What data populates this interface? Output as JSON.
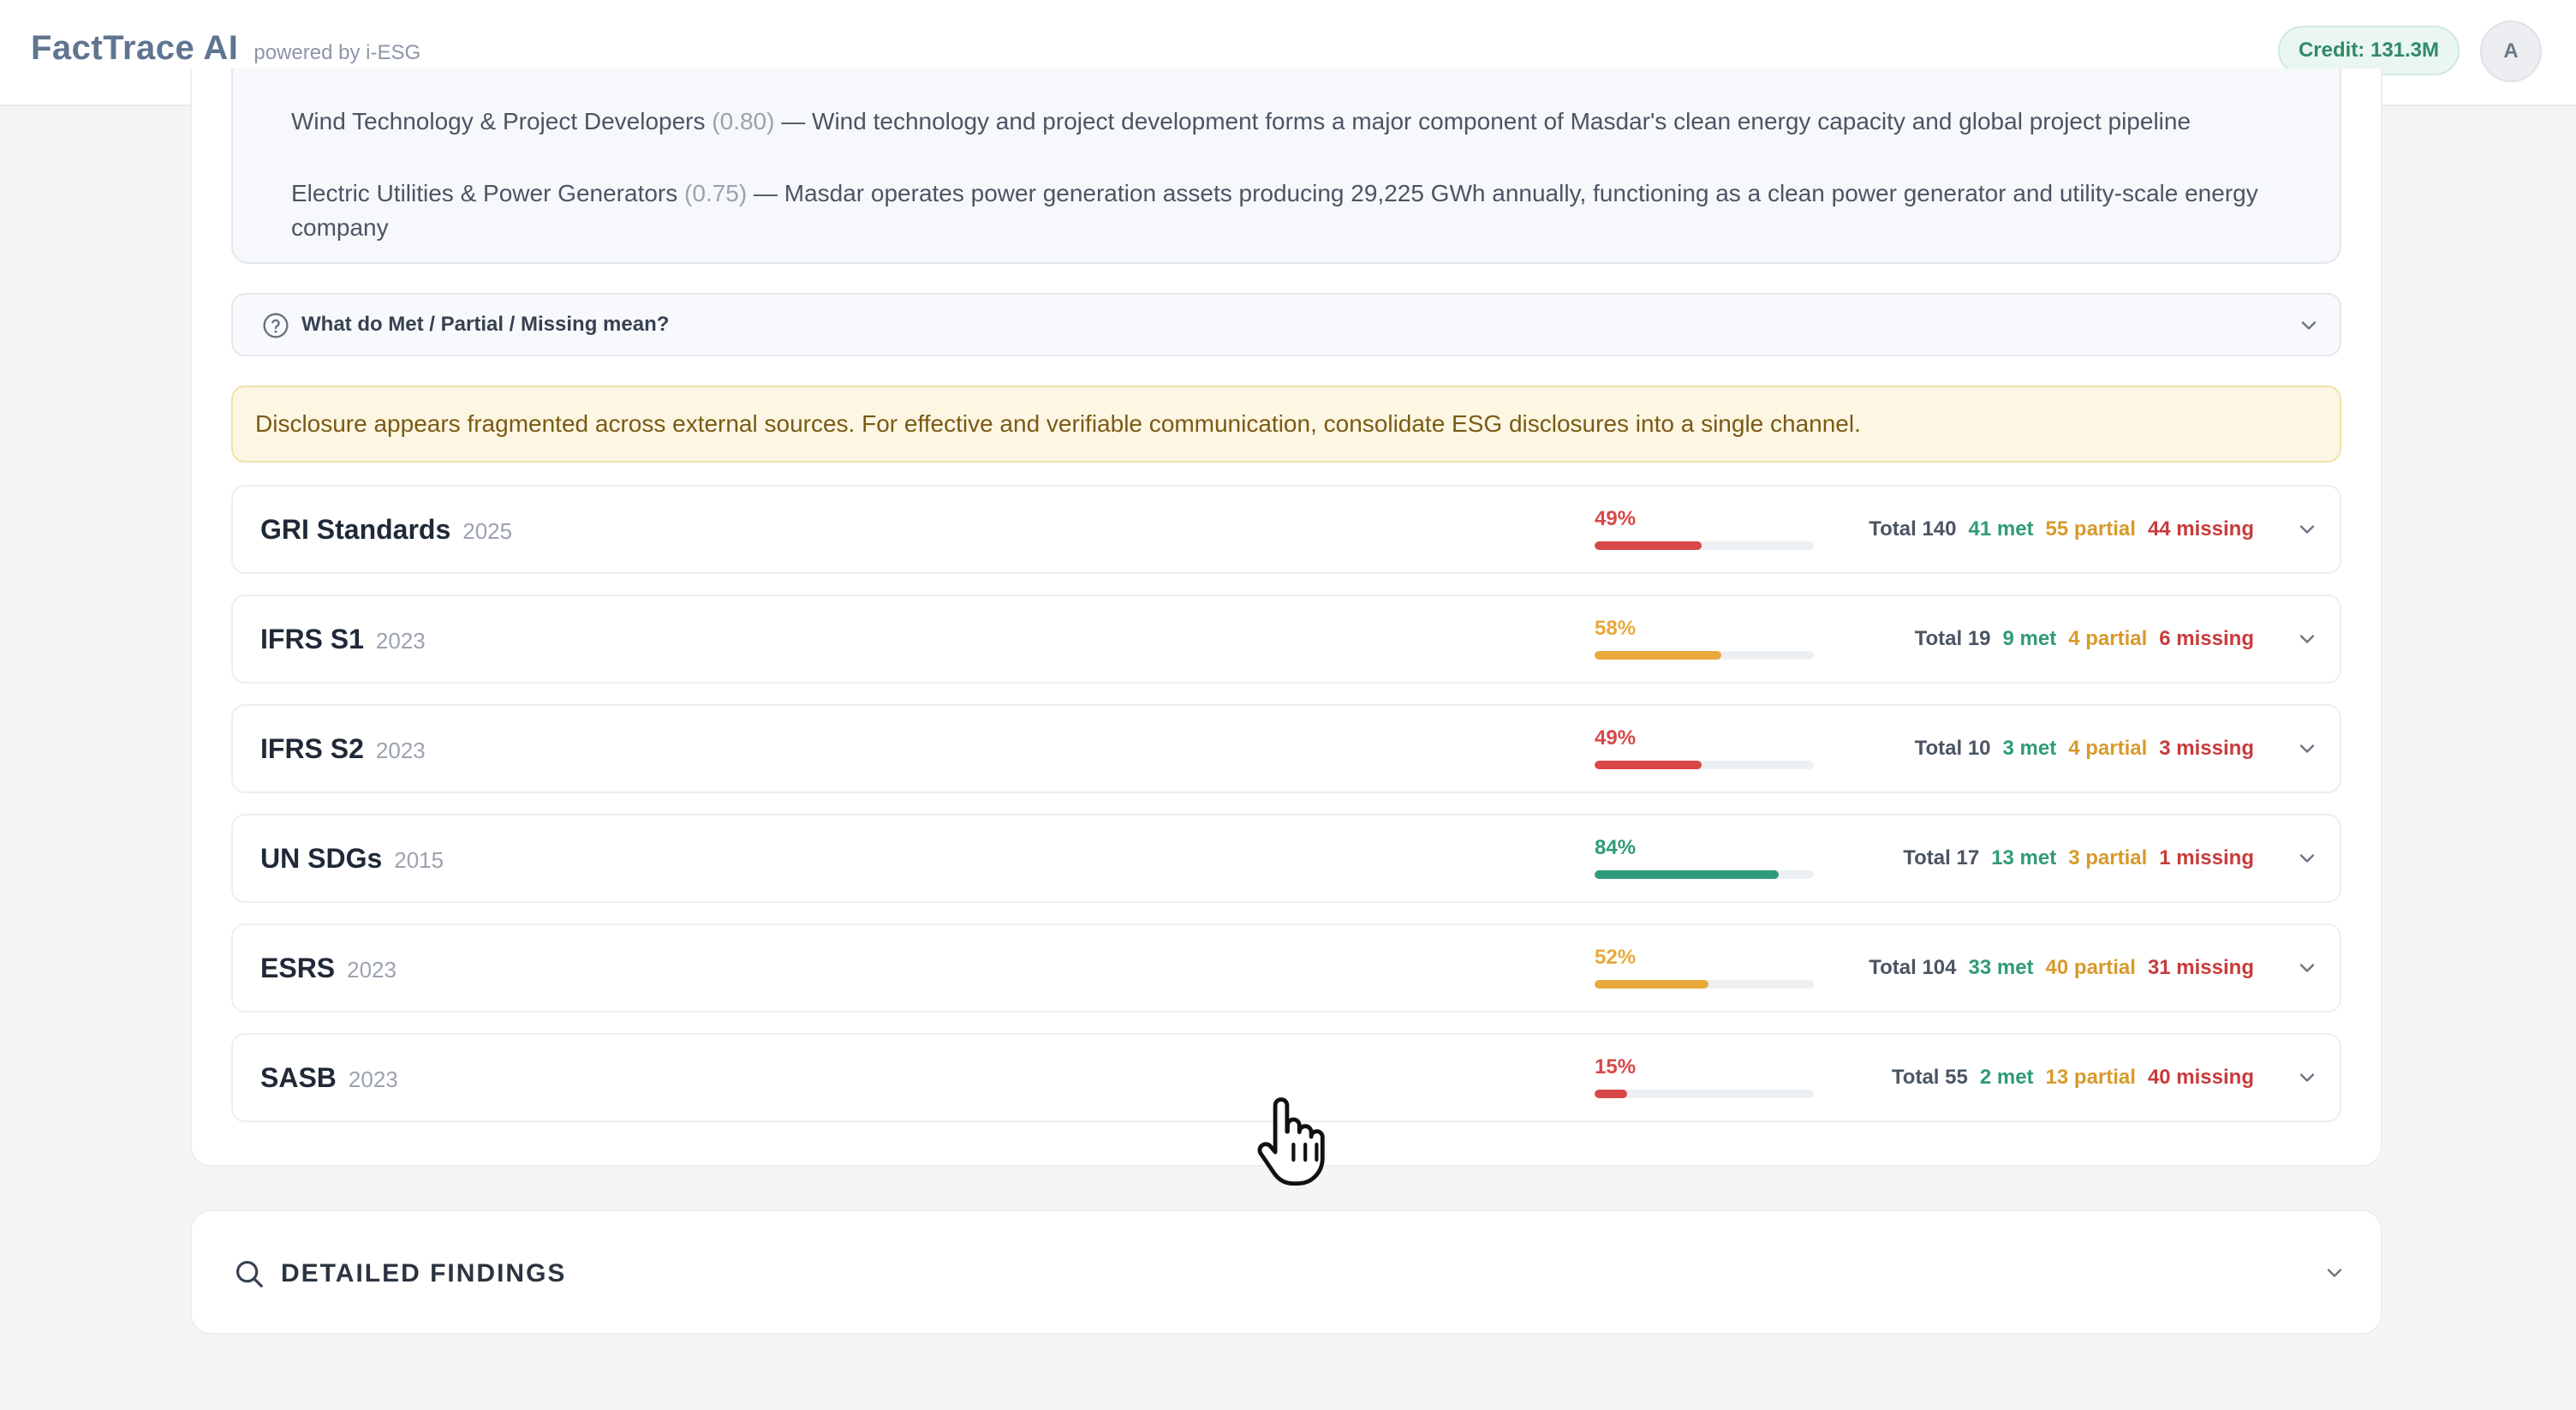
{
  "header": {
    "brand_name": "FactTrace AI",
    "brand_sub": "powered by i-ESG",
    "credit": "Credit: 131.3M",
    "avatar_initial": "A"
  },
  "industries": [
    {
      "name": "Wind Technology & Project Developers",
      "score": "(0.80)",
      "desc": "— Wind technology and project development forms a major component of Masdar's clean energy capacity and global project pipeline"
    },
    {
      "name": "Electric Utilities & Power Generators",
      "score": "(0.75)",
      "desc": "— Masdar operates power generation assets producing 29,225 GWh annually, functioning as a clean power generator and utility-scale energy company"
    }
  ],
  "explainer": {
    "label": "What do Met / Partial / Missing mean?"
  },
  "warning": "Disclosure appears fragmented across external sources. For effective and verifiable communication, consolidate ESG disclosures into a single channel.",
  "frameworks": [
    {
      "name": "GRI Standards",
      "year": "2025",
      "pct": "49%",
      "fraction": 0.49,
      "color": "#d94848",
      "total": "Total 140",
      "met": "41 met",
      "partial": "55 partial",
      "missing": "44 missing"
    },
    {
      "name": "IFRS S1",
      "year": "2023",
      "pct": "58%",
      "fraction": 0.58,
      "color": "#e8a93a",
      "total": "Total 19",
      "met": "9 met",
      "partial": "4 partial",
      "missing": "6 missing"
    },
    {
      "name": "IFRS S2",
      "year": "2023",
      "pct": "49%",
      "fraction": 0.49,
      "color": "#d94848",
      "total": "Total 10",
      "met": "3 met",
      "partial": "4 partial",
      "missing": "3 missing"
    },
    {
      "name": "UN SDGs",
      "year": "2015",
      "pct": "84%",
      "fraction": 0.84,
      "color": "#2f9a7a",
      "total": "Total 17",
      "met": "13 met",
      "partial": "3 partial",
      "missing": "1 missing"
    },
    {
      "name": "ESRS",
      "year": "2023",
      "pct": "52%",
      "fraction": 0.52,
      "color": "#e8a93a",
      "total": "Total 104",
      "met": "33 met",
      "partial": "40 partial",
      "missing": "31 missing"
    },
    {
      "name": "SASB",
      "year": "2023",
      "pct": "15%",
      "fraction": 0.15,
      "color": "#d94848",
      "total": "Total 55",
      "met": "2 met",
      "partial": "13 partial",
      "missing": "40 missing"
    }
  ],
  "findings": {
    "title": "DETAILED FINDINGS"
  },
  "icons": {
    "help": "question-circle-icon",
    "expand": "chevron-down-icon",
    "search": "search-icon",
    "cursor": "hand-pointer-icon"
  }
}
